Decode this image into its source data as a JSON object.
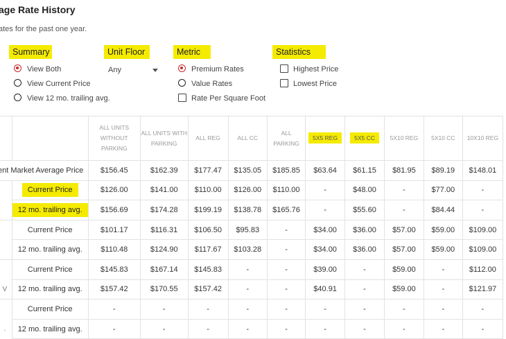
{
  "page": {
    "title": "age Rate History",
    "subtitle": "ates for the past one year."
  },
  "filters": {
    "summary": {
      "label": "Summary",
      "options": [
        {
          "label": "View Both",
          "selected": true
        },
        {
          "label": "View Current Price",
          "selected": false
        },
        {
          "label": "View 12 mo. trailing avg.",
          "selected": false
        }
      ]
    },
    "unit_floor": {
      "label": "Unit Floor",
      "value": "Any"
    },
    "metric": {
      "label": "Metric",
      "options": [
        {
          "label": "Premium Rates",
          "selected": true
        },
        {
          "label": "Value Rates",
          "selected": false
        }
      ],
      "checkbox": {
        "label": "Rate Per Square Foot",
        "checked": false
      }
    },
    "statistics": {
      "label": "Statistics",
      "options": [
        {
          "label": "Highest Price",
          "checked": false
        },
        {
          "label": "Lowest Price",
          "checked": false
        }
      ]
    }
  },
  "colors": {
    "highlight": "#f5eb00",
    "radio_selected": "#c62828"
  },
  "table": {
    "columns": [
      "ALL UNITS WITHOUT PARKING",
      "ALL UNITS WITH PARKING",
      "ALL REG",
      "ALL CC",
      "ALL PARKING",
      "5X5 REG",
      "5X5 CC",
      "5X10 REG",
      "5X10 CC",
      "10X10 REG"
    ],
    "rows": [
      {
        "label": "ent Market Average Price",
        "values": [
          "$156.45",
          "$162.39",
          "$177.47",
          "$135.05",
          "$185.85",
          "$63.64",
          "$61.15",
          "$81.95",
          "$89.19",
          "$148.01"
        ]
      },
      {
        "label": "Current Price",
        "values": [
          "$126.00",
          "$141.00",
          "$110.00",
          "$126.00",
          "$110.00",
          "-",
          "$48.00",
          "-",
          "$77.00",
          "-"
        ]
      },
      {
        "label": "12 mo. trailing avg.",
        "values": [
          "$156.69",
          "$174.28",
          "$199.19",
          "$138.78",
          "$165.76",
          "-",
          "$55.60",
          "-",
          "$84.44",
          "-"
        ]
      },
      {
        "label": "Current Price",
        "values": [
          "$101.17",
          "$116.31",
          "$106.50",
          "$95.83",
          "-",
          "$34.00",
          "$36.00",
          "$57.00",
          "$59.00",
          "$109.00"
        ]
      },
      {
        "label": "12 mo. trailing avg.",
        "values": [
          "$110.48",
          "$124.90",
          "$117.67",
          "$103.28",
          "-",
          "$34.00",
          "$36.00",
          "$57.00",
          "$59.00",
          "$109.00"
        ]
      },
      {
        "label": "Current Price",
        "values": [
          "$145.83",
          "$167.14",
          "$145.83",
          "-",
          "-",
          "$39.00",
          "-",
          "$59.00",
          "-",
          "$112.00"
        ]
      },
      {
        "label": "12 mo. trailing avg.",
        "values": [
          "$157.42",
          "$170.55",
          "$157.42",
          "-",
          "-",
          "$40.91",
          "-",
          "$59.00",
          "-",
          "$121.97"
        ]
      },
      {
        "label": "Current Price",
        "values": [
          "-",
          "-",
          "-",
          "-",
          "-",
          "-",
          "-",
          "-",
          "-",
          "-"
        ]
      },
      {
        "label": "12 mo. trailing avg.",
        "values": [
          "-",
          "-",
          "-",
          "-",
          "-",
          "-",
          "-",
          "-",
          "-",
          "-"
        ]
      }
    ],
    "group_marks": [
      "V",
      "."
    ]
  }
}
